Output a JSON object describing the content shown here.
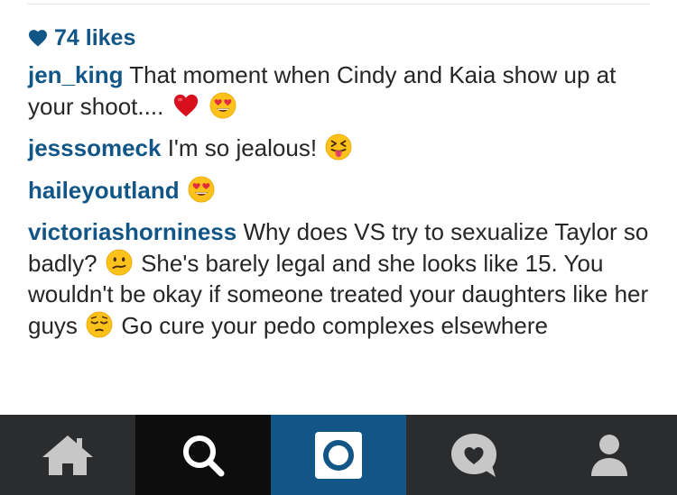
{
  "likes": {
    "count_text": "74 likes",
    "icon": "heart-icon"
  },
  "comments": [
    {
      "username": "jen_king",
      "text": "That moment when Cindy and Kaia show up at your shoot....",
      "emojis": [
        "red-heart-emoji",
        "heart-eyes-emoji"
      ]
    },
    {
      "username": "jesssomeck",
      "text": "I'm so jealous!",
      "emojis": [
        "squinting-tongue-emoji"
      ]
    },
    {
      "username": "haileyoutland",
      "text": "",
      "emojis": [
        "heart-eyes-emoji"
      ]
    },
    {
      "username": "victoriashorniness",
      "text_1": "Why does VS try to sexualize Taylor so badly?",
      "text_2": "She's barely legal and she looks like 15. You wouldn't be okay if someone treated your daughters like her guys",
      "text_3": "Go cure your pedo complexes elsewhere",
      "emojis": [
        "confused-face-emoji",
        "pensive-face-emoji"
      ]
    }
  ],
  "tabbar": {
    "tabs": [
      {
        "name": "home",
        "icon": "home-icon"
      },
      {
        "name": "search",
        "icon": "search-icon"
      },
      {
        "name": "camera",
        "icon": "camera-icon"
      },
      {
        "name": "activity",
        "icon": "activity-heart-bubble-icon"
      },
      {
        "name": "profile",
        "icon": "profile-icon"
      }
    ],
    "colors": {
      "bar": "#2b2c2e",
      "active_search": "#0d0d0e",
      "camera": "#125688",
      "icon": "#c7c7c7"
    }
  },
  "colors": {
    "username": "#125688",
    "text": "#262626"
  }
}
